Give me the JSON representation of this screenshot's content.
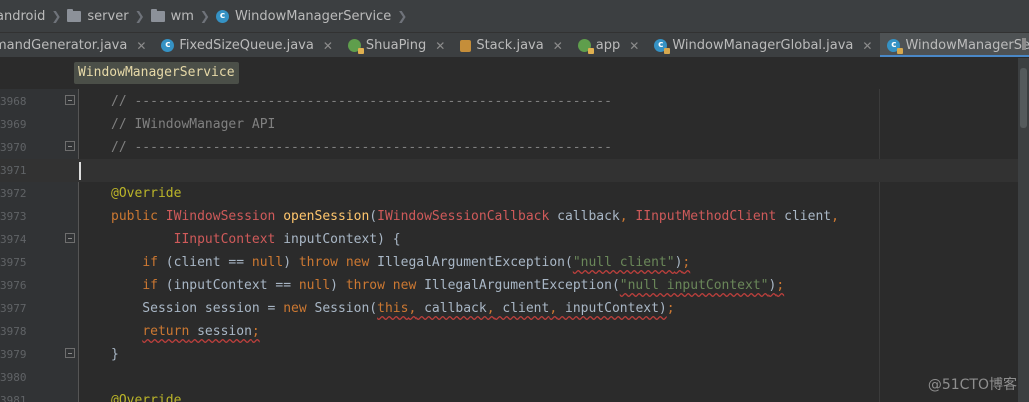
{
  "breadcrumb": [
    {
      "label": "android",
      "icon": "none"
    },
    {
      "label": "server",
      "icon": "folder-icon"
    },
    {
      "label": "wm",
      "icon": "folder-icon"
    },
    {
      "label": "WindowManagerService",
      "icon": "class-icon"
    }
  ],
  "tabs": [
    {
      "label": "mandGenerator.java",
      "icon": "none",
      "active": false
    },
    {
      "label": "FixedSizeQueue.java",
      "icon": "class-icon",
      "active": false
    },
    {
      "label": "ShuaPing",
      "icon": "run-config-icon",
      "active": false
    },
    {
      "label": "Stack.java",
      "icon": "stack-file-icon",
      "active": false
    },
    {
      "label": "app",
      "icon": "run-config-icon",
      "active": false
    },
    {
      "label": "WindowManagerGlobal.java",
      "icon": "locked-class-icon",
      "active": false
    },
    {
      "label": "WindowManagerService.java",
      "icon": "locked-class-icon",
      "active": true
    }
  ],
  "tooltip": "WindowManagerService",
  "editor": {
    "lines": [
      {
        "number": "3968",
        "text": "// -------------------------------------------------------------"
      },
      {
        "number": "3969",
        "text": "// IWindowManager API"
      },
      {
        "number": "3970",
        "text": "// -------------------------------------------------------------"
      },
      {
        "number": "3971",
        "text": ""
      },
      {
        "number": "3972",
        "text": "@Override"
      },
      {
        "number": "3973",
        "text": "public IWindowSession openSession(IWindowSessionCallback callback, IInputMethodClient client,"
      },
      {
        "number": "3974",
        "text": "        IInputContext inputContext) {"
      },
      {
        "number": "3975",
        "text": "    if (client == null) throw new IllegalArgumentException(\"null client\");"
      },
      {
        "number": "3976",
        "text": "    if (inputContext == null) throw new IllegalArgumentException(\"null inputContext\");"
      },
      {
        "number": "3977",
        "text": "    Session session = new Session(this, callback, client, inputContext);"
      },
      {
        "number": "3978",
        "text": "    return session;"
      },
      {
        "number": "3979",
        "text": "}"
      },
      {
        "number": "3980",
        "text": ""
      },
      {
        "number": "3981",
        "text": "@Override"
      }
    ]
  },
  "watermark": "@51CTO博客",
  "colors": {
    "editor_bg": "#2b2b2b",
    "comment": "#808080",
    "annotation": "#bbb529",
    "keyword": "#cc7832",
    "type_error": "#cf5a5a",
    "method": "#ffc66d",
    "string": "#6a8759",
    "active_tab_underline": "#4a88c7"
  }
}
